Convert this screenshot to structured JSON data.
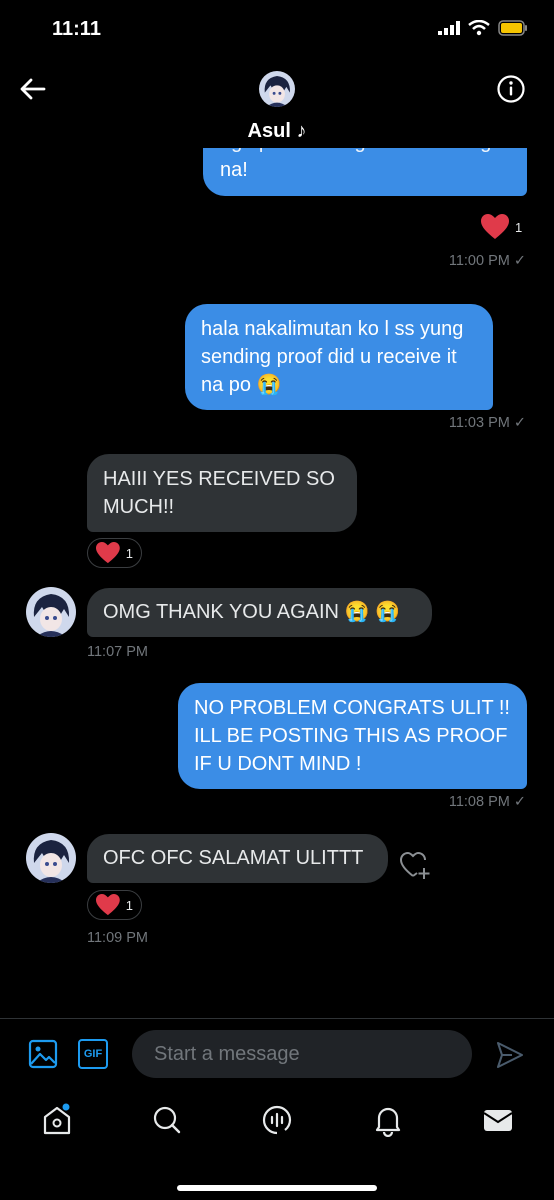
{
  "status": {
    "time": "11:11"
  },
  "header": {
    "name": "Asul ♪"
  },
  "messages": {
    "m1": {
      "text": "na!",
      "partial": "oge po wait lang hehe sending",
      "reaction_count": "1",
      "time": "11:00 PM ✓"
    },
    "m2": {
      "text": "hala nakalimutan ko l ss yung sending proof did u receive it na po 😭",
      "time": "11:03 PM ✓"
    },
    "m3": {
      "text": "HAIII YES RECEIVED SO MUCH!!",
      "reaction_count": "1"
    },
    "m4": {
      "text": "OMG THANK YOU AGAIN 😭 😭",
      "time": "11:07 PM"
    },
    "m5": {
      "text": "NO PROBLEM CONGRATS ULIT !! ILL BE POSTING THIS AS PROOF IF U DONT MIND !",
      "time": "11:08 PM ✓"
    },
    "m6": {
      "text": "OFC OFC SALAMAT ULITTT",
      "reaction_count": "1",
      "time": "11:09 PM"
    }
  },
  "composer": {
    "placeholder": "Start a message",
    "gif_label": "GIF"
  },
  "colors": {
    "accent": "#1d9bf0",
    "bubble_out": "#3b8de6",
    "bubble_in": "#2f3336",
    "heart": "#f91880"
  },
  "icons": [
    "back-arrow-icon",
    "info-icon",
    "image-icon",
    "gif-icon",
    "send-icon",
    "home-icon",
    "search-icon",
    "spaces-icon",
    "bell-icon",
    "mail-icon",
    "heart-icon",
    "add-reaction-icon"
  ]
}
